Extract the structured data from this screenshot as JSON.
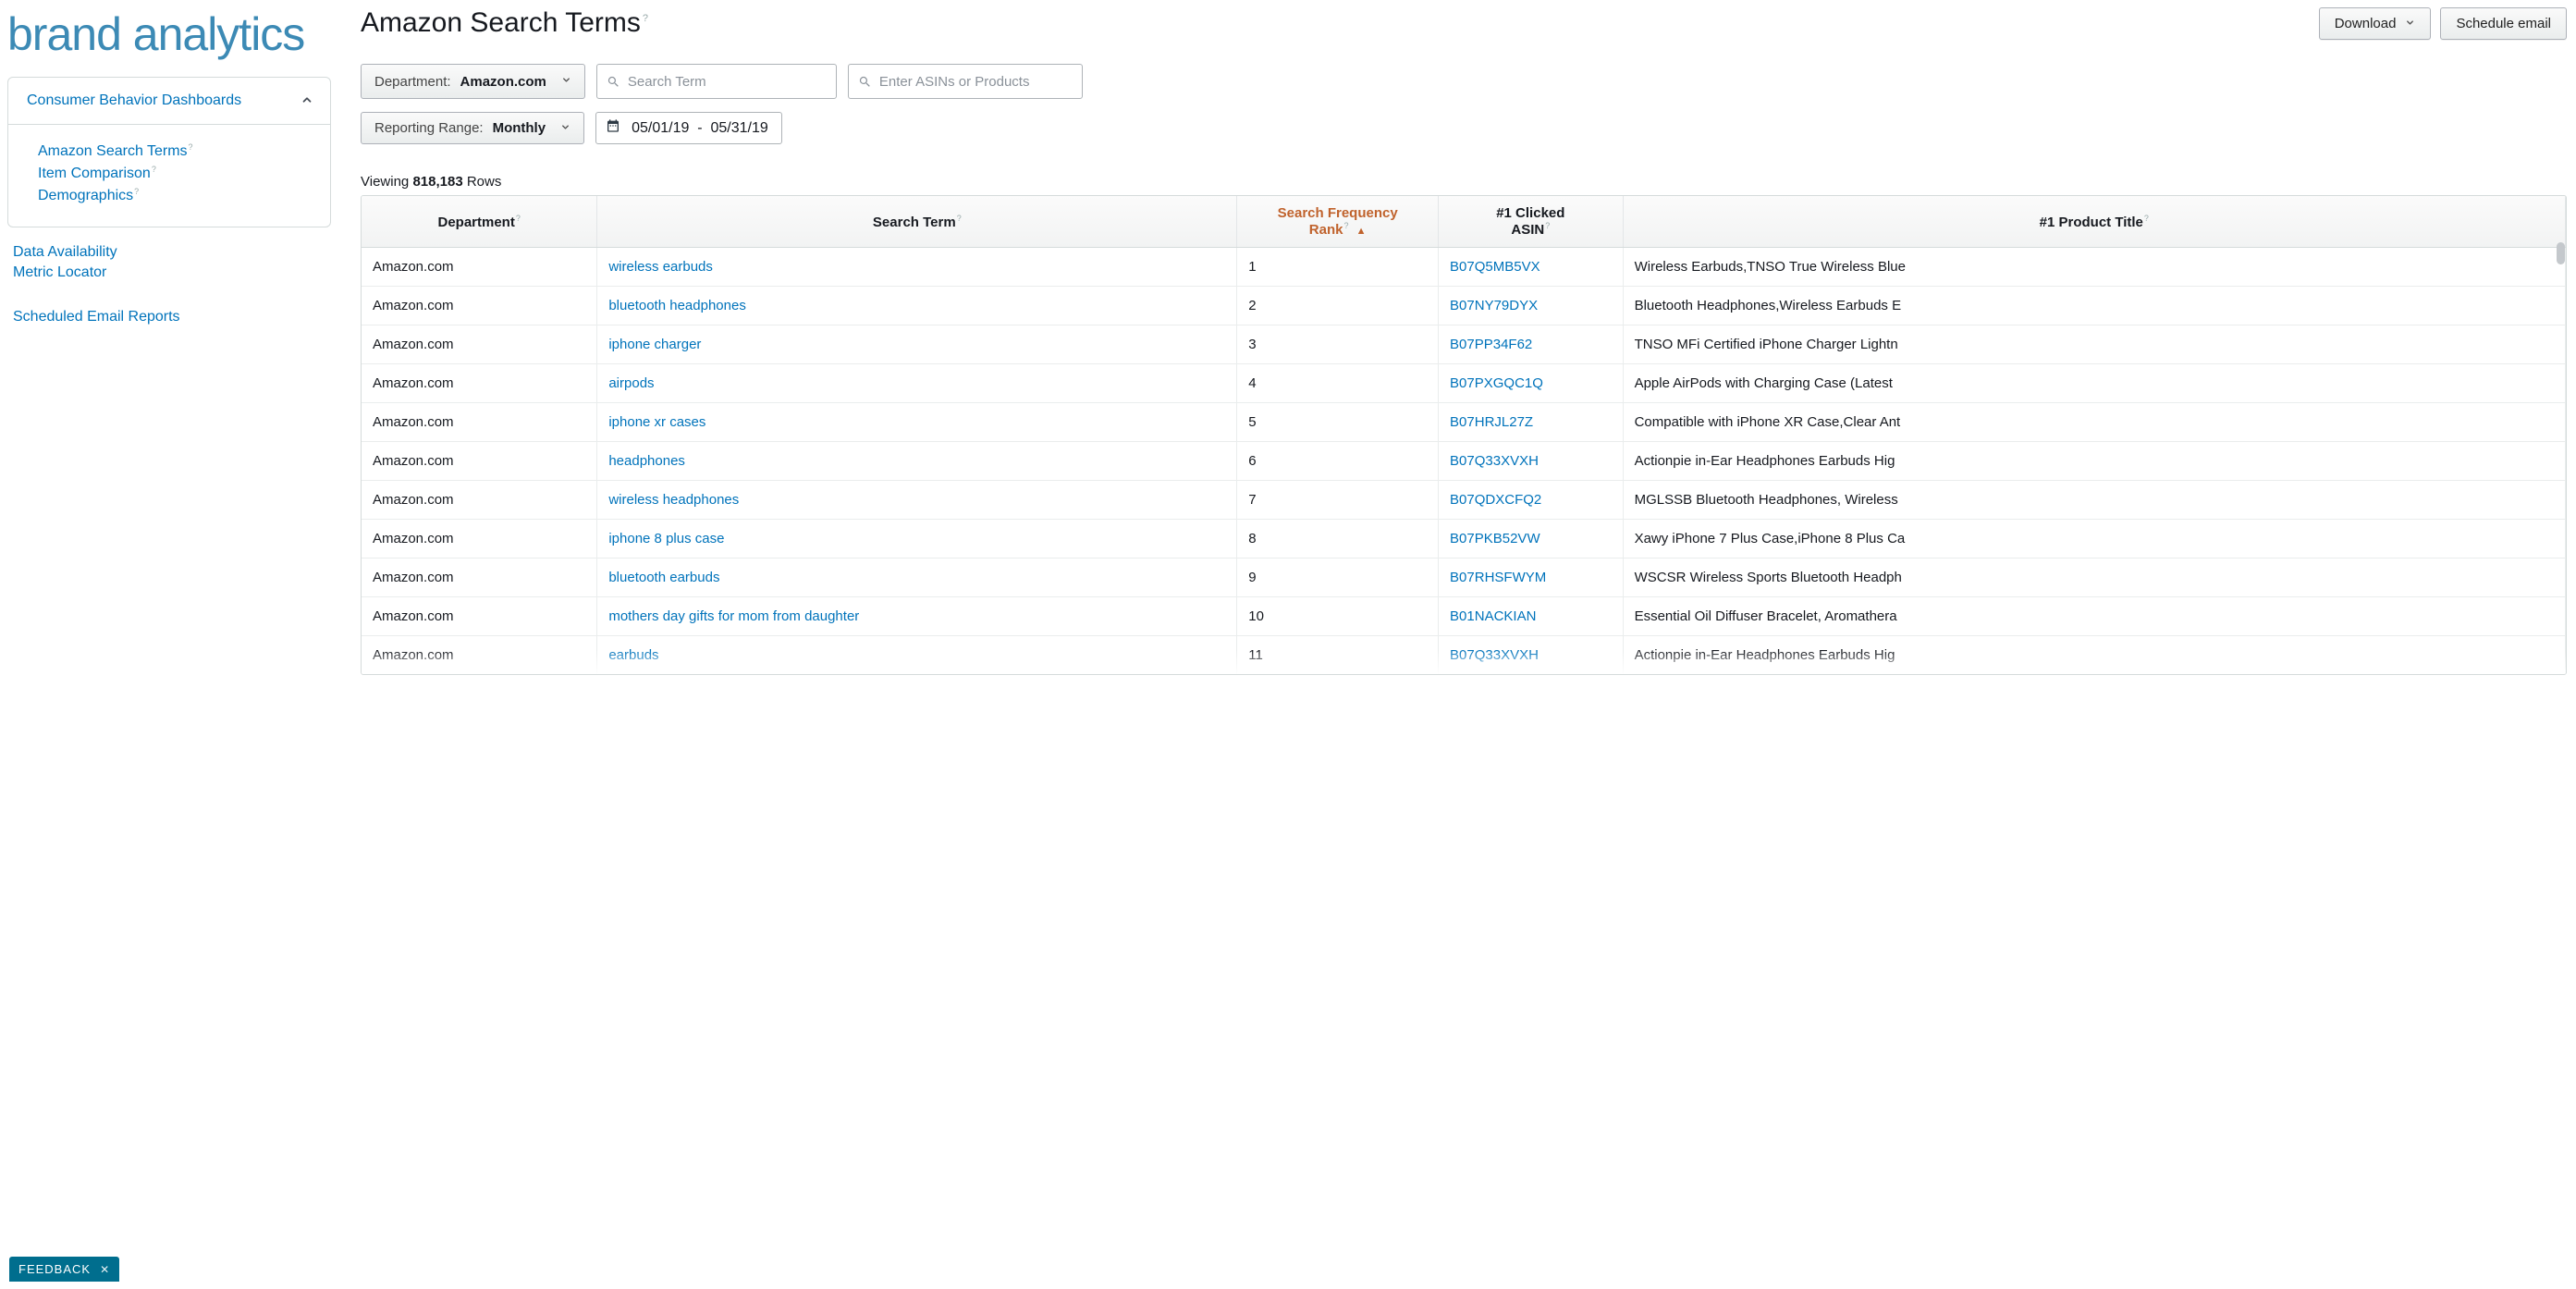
{
  "brand": "brand analytics",
  "sidebar": {
    "section_label": "Consumer Behavior Dashboards",
    "items": [
      {
        "label": "Amazon Search Terms",
        "q": true
      },
      {
        "label": "Item Comparison",
        "q": true
      },
      {
        "label": "Demographics",
        "q": true
      }
    ],
    "links": [
      {
        "label": "Data Availability"
      },
      {
        "label": "Metric Locator"
      },
      {
        "label": "Scheduled Email Reports",
        "gap_before": true
      }
    ]
  },
  "header": {
    "title": "Amazon Search Terms",
    "download_label": "Download",
    "schedule_label": "Schedule email"
  },
  "filters": {
    "department_lead": "Department:",
    "department_value": "Amazon.com",
    "search_term_placeholder": "Search Term",
    "asin_placeholder": "Enter ASINs or Products",
    "range_lead": "Reporting Range:",
    "range_value": "Monthly",
    "date_from": "05/01/19",
    "date_to": "05/31/19"
  },
  "results": {
    "viewing_prefix": "Viewing ",
    "row_count": "818,183",
    "viewing_suffix": " Rows",
    "columns": [
      {
        "key": "dept",
        "label": "Department",
        "q": true
      },
      {
        "key": "term",
        "label": "Search Term",
        "q": true
      },
      {
        "key": "rank",
        "label": "Search Frequency Rank",
        "q": true,
        "sorted": "asc"
      },
      {
        "key": "asin",
        "label": "#1 Clicked ASIN",
        "q": true
      },
      {
        "key": "title",
        "label": "#1 Product Title",
        "q": true
      }
    ],
    "rows": [
      {
        "dept": "Amazon.com",
        "term": "wireless earbuds",
        "rank": "1",
        "asin": "B07Q5MB5VX",
        "title": "Wireless Earbuds,TNSO True Wireless Blue"
      },
      {
        "dept": "Amazon.com",
        "term": "bluetooth headphones",
        "rank": "2",
        "asin": "B07NY79DYX",
        "title": "Bluetooth Headphones,Wireless Earbuds E"
      },
      {
        "dept": "Amazon.com",
        "term": "iphone charger",
        "rank": "3",
        "asin": "B07PP34F62",
        "title": "TNSO MFi Certified iPhone Charger Lightn"
      },
      {
        "dept": "Amazon.com",
        "term": "airpods",
        "rank": "4",
        "asin": "B07PXGQC1Q",
        "title": "Apple AirPods with Charging Case (Latest"
      },
      {
        "dept": "Amazon.com",
        "term": "iphone xr cases",
        "rank": "5",
        "asin": "B07HRJL27Z",
        "title": "Compatible with iPhone XR Case,Clear Ant"
      },
      {
        "dept": "Amazon.com",
        "term": "headphones",
        "rank": "6",
        "asin": "B07Q33XVXH",
        "title": "Actionpie in-Ear Headphones Earbuds Hig"
      },
      {
        "dept": "Amazon.com",
        "term": "wireless headphones",
        "rank": "7",
        "asin": "B07QDXCFQ2",
        "title": "MGLSSB Bluetooth Headphones, Wireless"
      },
      {
        "dept": "Amazon.com",
        "term": "iphone 8 plus case",
        "rank": "8",
        "asin": "B07PKB52VW",
        "title": "Xawy iPhone 7 Plus Case,iPhone 8 Plus Ca"
      },
      {
        "dept": "Amazon.com",
        "term": "bluetooth earbuds",
        "rank": "9",
        "asin": "B07RHSFWYM",
        "title": "WSCSR Wireless Sports Bluetooth Headph"
      },
      {
        "dept": "Amazon.com",
        "term": "mothers day gifts for mom from daughter",
        "rank": "10",
        "asin": "B01NACKIAN",
        "title": "Essential Oil Diffuser Bracelet, Aromathera"
      },
      {
        "dept": "Amazon.com",
        "term": "earbuds",
        "rank": "11",
        "asin": "B07Q33XVXH",
        "title": "Actionpie in-Ear Headphones Earbuds Hig"
      }
    ]
  },
  "feedback": {
    "label": "FEEDBACK"
  }
}
